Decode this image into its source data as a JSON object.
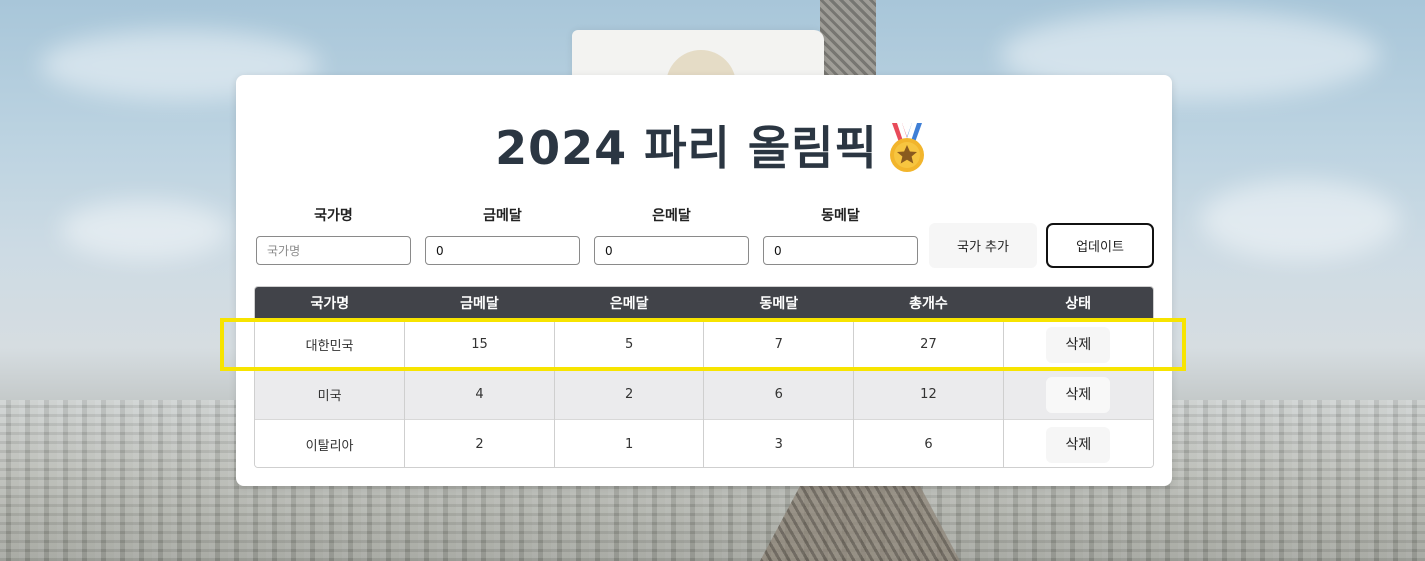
{
  "page": {
    "title": "2024 파리 올림픽"
  },
  "form": {
    "fields": [
      {
        "label": "국가명",
        "value": "",
        "placeholder": "국가명"
      },
      {
        "label": "금메달",
        "value": "0",
        "placeholder": ""
      },
      {
        "label": "은메달",
        "value": "0",
        "placeholder": ""
      },
      {
        "label": "동메달",
        "value": "0",
        "placeholder": ""
      }
    ],
    "add_label": "국가 추가",
    "update_label": "업데이트"
  },
  "table": {
    "headers": [
      "국가명",
      "금메달",
      "은메달",
      "동메달",
      "총개수",
      "상태"
    ],
    "rows": [
      {
        "country": "대한민국",
        "gold": "15",
        "silver": "5",
        "bronze": "7",
        "total": "27",
        "action": "삭제"
      },
      {
        "country": "미국",
        "gold": "4",
        "silver": "2",
        "bronze": "6",
        "total": "12",
        "action": "삭제"
      },
      {
        "country": "이탈리아",
        "gold": "2",
        "silver": "1",
        "bronze": "3",
        "total": "6",
        "action": "삭제"
      }
    ]
  },
  "colors": {
    "header_bg": "#414349",
    "title": "#2b3642",
    "highlight": "#f7e400",
    "medal_gold": "#f2b52c"
  },
  "icons": {
    "title_icon": "medal-icon"
  }
}
